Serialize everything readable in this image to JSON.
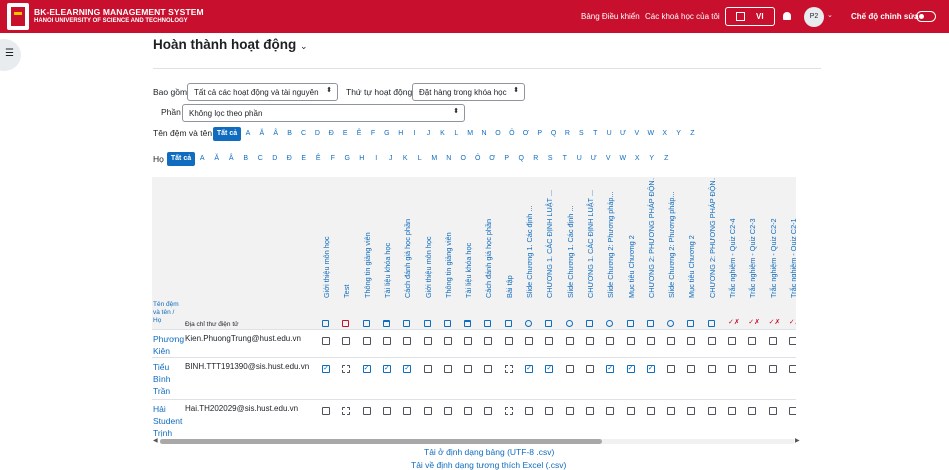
{
  "header": {
    "brand_title": "BK-ELEARNING MANAGEMENT SYSTEM",
    "brand_subtitle": "HANOI UNIVERSITY OF SCIENCE AND TECHNOLOGY",
    "nav_dashboard": "Bảng Điều khiển",
    "nav_my_courses": "Các khoá học của tôi",
    "language": "VI",
    "avatar_initials": "P2",
    "edit_mode_label": "Chế độ chỉnh sửa",
    "edit_mode_on": false
  },
  "page": {
    "title": "Hoàn thành hoạt động"
  },
  "filters": {
    "include_label": "Bao gồm",
    "include_value": "Tất cả các hoạt động và tài nguyên",
    "order_label": "Thứ tự hoạt động",
    "order_value": "Đặt hàng trong khóa học",
    "section_label": "Phần",
    "section_value": "Không lọc theo phần",
    "firstname_label": "Tên đệm và tên",
    "lastname_label": "Họ",
    "all_label": "Tất cả",
    "letters": [
      "A",
      "Ă",
      "Â",
      "B",
      "C",
      "D",
      "Đ",
      "E",
      "Ê",
      "F",
      "G",
      "H",
      "I",
      "J",
      "K",
      "L",
      "M",
      "N",
      "O",
      "Ô",
      "Ơ",
      "P",
      "Q",
      "R",
      "S",
      "T",
      "U",
      "Ư",
      "V",
      "W",
      "X",
      "Y",
      "Z"
    ]
  },
  "table": {
    "name_header": "Tên đệm và tên / Họ",
    "email_header": "Địa chỉ thư điện tử",
    "activities": [
      {
        "name": "Giới thiệu môn học",
        "icon": "page-icon"
      },
      {
        "name": "Test",
        "icon": "quiz-icon"
      },
      {
        "name": "Thông tin giảng viên",
        "icon": "page-icon"
      },
      {
        "name": "Tài liệu khóa học",
        "icon": "folder-icon"
      },
      {
        "name": "Cách đánh giá học phần",
        "icon": "page-icon"
      },
      {
        "name": "Giới thiệu môn học",
        "icon": "page-icon"
      },
      {
        "name": "Thông tin giảng viên",
        "icon": "page-icon"
      },
      {
        "name": "Tài liệu khóa học",
        "icon": "folder-icon"
      },
      {
        "name": "Cách đánh giá học phần",
        "icon": "page-icon"
      },
      {
        "name": "Bài tập",
        "icon": "assignment-icon"
      },
      {
        "name": "Slide Chương 1. Các định ...",
        "icon": "url-icon"
      },
      {
        "name": "CHƯƠNG 1. CÁC ĐỊNH LUẬT ...",
        "icon": "page-icon"
      },
      {
        "name": "Slide Chương 1. Các định ...",
        "icon": "url-icon"
      },
      {
        "name": "CHƯƠNG 1. CÁC ĐỊNH LUẬT ...",
        "icon": "page-icon"
      },
      {
        "name": "Slide Chương 2: Phương pháp...",
        "icon": "url-icon"
      },
      {
        "name": "Mục tiêu Chương 2",
        "icon": "page-icon"
      },
      {
        "name": "CHƯƠNG 2: PHƯƠNG PHÁP ĐỘNG ...",
        "icon": "page-icon"
      },
      {
        "name": "Slide Chương 2: Phương pháp...",
        "icon": "url-icon"
      },
      {
        "name": "Mục tiêu Chương 2",
        "icon": "page-icon"
      },
      {
        "name": "CHƯƠNG 2: PHƯƠNG PHÁP ĐỘNG ...",
        "icon": "page-icon"
      },
      {
        "name": "Trắc nghiệm - Quiz C2-4",
        "icon": "quiz-icon"
      },
      {
        "name": "Trắc nghiệm - Quiz C2-3",
        "icon": "quiz-icon"
      },
      {
        "name": "Trắc nghiệm - Quiz C2-2",
        "icon": "quiz-icon"
      },
      {
        "name": "Trắc nghiệm - Quiz C2-1",
        "icon": "quiz-icon"
      }
    ],
    "rows": [
      {
        "name": "Phương Kiên",
        "email": "Kien.PhuongTrung@hust.edu.vn",
        "status": [
          0,
          0,
          0,
          0,
          0,
          0,
          0,
          0,
          0,
          0,
          0,
          0,
          0,
          0,
          0,
          0,
          0,
          0,
          0,
          0,
          0,
          0,
          0,
          0
        ]
      },
      {
        "name": "Tiểu Bình Trần",
        "email": "BINH.TTT191390@sis.hust.edu.vn",
        "status": [
          1,
          2,
          1,
          1,
          1,
          0,
          0,
          0,
          0,
          2,
          1,
          1,
          0,
          0,
          1,
          1,
          1,
          0,
          0,
          0,
          0,
          0,
          0,
          0
        ]
      },
      {
        "name": "Hải Student Trịnh",
        "email": "Hai.TH202029@sis.hust.edu.vn",
        "status": [
          0,
          2,
          0,
          0,
          0,
          0,
          0,
          0,
          0,
          2,
          0,
          0,
          0,
          0,
          0,
          0,
          0,
          0,
          0,
          0,
          0,
          0,
          0,
          0
        ]
      }
    ]
  },
  "downloads": {
    "csv": "Tải ở định dạng bảng (UTF-8 .csv)",
    "excel": "Tải về định dạng tương thích Excel (.csv)"
  },
  "colors": {
    "brand_red": "#c8102e",
    "link_blue": "#0f6cbf"
  }
}
